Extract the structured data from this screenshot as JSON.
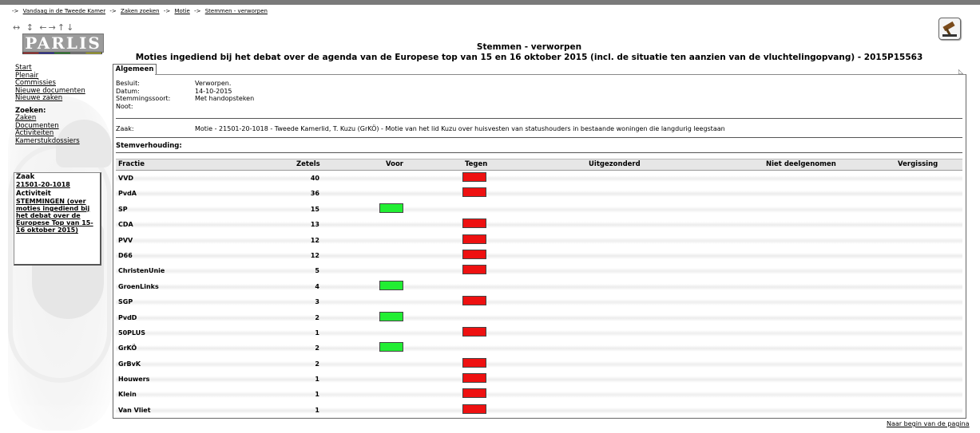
{
  "breadcrumb": {
    "items": [
      "Vandaag in de Tweede Kamer",
      "Zaken zoeken",
      "Motie",
      "Stemmen - verworpen"
    ],
    "separator": "->"
  },
  "logo": {
    "text": "PARLIS"
  },
  "nav": {
    "links": [
      "Start",
      "Plenair",
      "Commissies",
      "Nieuwe documenten",
      "Nieuwe zaken"
    ],
    "search_header": "Zoeken:",
    "search_links": [
      "Zaken",
      "Documenten",
      "Activiteiten",
      "Kamerstukdossiers"
    ]
  },
  "zaakbox": {
    "zaak_header": "Zaak",
    "zaak_link": "21501-20-1018",
    "activiteit_header": "Activiteit",
    "activiteit_link": "STEMMINGEN (over moties ingediend bij het debat over de Europese Top van 15-16 oktober 2015)"
  },
  "header": {
    "title": "Stemmen - verworpen",
    "subtitle": "Moties ingediend bij het debat over de agenda van de Europese top van 15 en 16 oktober 2015 (incl. de situatie ten aanzien van de vluchtelingopvang) - 2015P15563"
  },
  "tab": {
    "label": "Algemeen"
  },
  "info": {
    "besluit_label": "Besluit:",
    "besluit_value": "Verworpen.",
    "datum_label": "Datum:",
    "datum_value": "14-10-2015",
    "stemmingssoort_label": "Stemmingssoort:",
    "stemmingssoort_value": "Met handopsteken",
    "noot_label": "Noot:",
    "noot_value": "",
    "zaak_label": "Zaak:",
    "zaak_value": "Motie - 21501-20-1018 - Tweede Kamerlid, T. Kuzu (GrKÖ) - Motie van het lid Kuzu over huisvesten van statushouders in bestaande woningen die langdurig leegstaan"
  },
  "stemverhouding": {
    "label": "Stemverhouding:"
  },
  "table": {
    "headers": {
      "fractie": "Fractie",
      "zetels": "Zetels",
      "voor": "Voor",
      "tegen": "Tegen",
      "uitgezonderd": "Uitgezonderd",
      "niet_deelgenomen": "Niet deelgenomen",
      "vergissing": "Vergissing"
    },
    "rows": [
      {
        "fractie": "VVD",
        "zetels": "40",
        "vote": "tegen"
      },
      {
        "fractie": "PvdA",
        "zetels": "36",
        "vote": "tegen"
      },
      {
        "fractie": "SP",
        "zetels": "15",
        "vote": "voor"
      },
      {
        "fractie": "CDA",
        "zetels": "13",
        "vote": "tegen"
      },
      {
        "fractie": "PVV",
        "zetels": "12",
        "vote": "tegen"
      },
      {
        "fractie": "D66",
        "zetels": "12",
        "vote": "tegen"
      },
      {
        "fractie": "ChristenUnie",
        "zetels": "5",
        "vote": "tegen"
      },
      {
        "fractie": "GroenLinks",
        "zetels": "4",
        "vote": "voor"
      },
      {
        "fractie": "SGP",
        "zetels": "3",
        "vote": "tegen"
      },
      {
        "fractie": "PvdD",
        "zetels": "2",
        "vote": "voor"
      },
      {
        "fractie": "50PLUS",
        "zetels": "1",
        "vote": "tegen"
      },
      {
        "fractie": "GrKÖ",
        "zetels": "2",
        "vote": "voor"
      },
      {
        "fractie": "GrBvK",
        "zetels": "2",
        "vote": "tegen"
      },
      {
        "fractie": "Houwers",
        "zetels": "1",
        "vote": "tegen"
      },
      {
        "fractie": "Klein",
        "zetels": "1",
        "vote": "tegen"
      },
      {
        "fractie": "Van Vliet",
        "zetels": "1",
        "vote": "tegen"
      }
    ]
  },
  "footer": {
    "top_link": "Naar begin van de pagina"
  },
  "colors": {
    "voor": "#22ee33",
    "tegen": "#ee1111"
  },
  "icons": {
    "top_right": "gavel-icon"
  }
}
